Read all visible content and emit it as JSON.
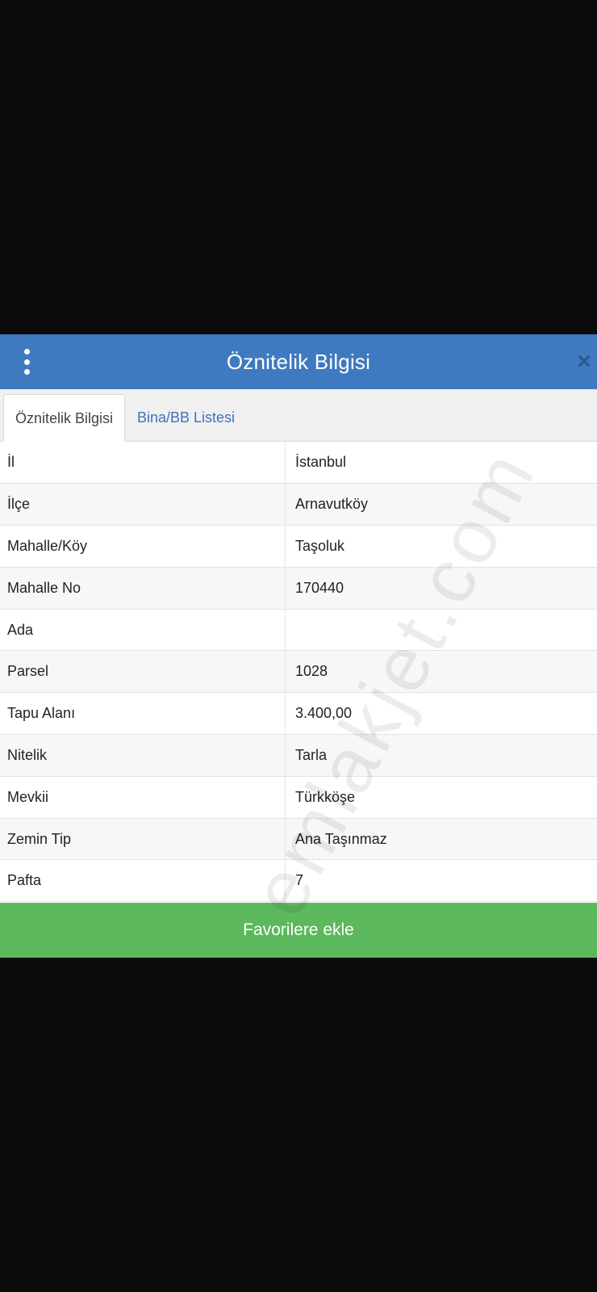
{
  "header": {
    "title": "Öznitelik Bilgisi",
    "close_label": "×"
  },
  "tabs": [
    {
      "label": "Öznitelik Bilgisi",
      "active": true
    },
    {
      "label": "Bina/BB Listesi",
      "active": false
    }
  ],
  "attributes": [
    {
      "key": "İl",
      "value": "İstanbul"
    },
    {
      "key": "İlçe",
      "value": "Arnavutköy"
    },
    {
      "key": "Mahalle/Köy",
      "value": "Taşoluk"
    },
    {
      "key": "Mahalle No",
      "value": "170440"
    },
    {
      "key": "Ada",
      "value": ""
    },
    {
      "key": "Parsel",
      "value": "1028"
    },
    {
      "key": "Tapu Alanı",
      "value": "3.400,00"
    },
    {
      "key": "Nitelik",
      "value": "Tarla"
    },
    {
      "key": "Mevkii",
      "value": "Türkköşe"
    },
    {
      "key": "Zemin Tip",
      "value": "Ana Taşınmaz"
    },
    {
      "key": "Pafta",
      "value": "7"
    }
  ],
  "favorite_button": {
    "label": "Favorilere ekle"
  },
  "watermark": {
    "text": "emlakjet.com"
  },
  "colors": {
    "header": "#3f7ac0",
    "tab_link": "#3b74b8",
    "favorite_button": "#5cb85c",
    "background": "#0b0b0b"
  },
  "icons": {
    "menu": "kebab-menu-icon",
    "close": "close-icon"
  }
}
